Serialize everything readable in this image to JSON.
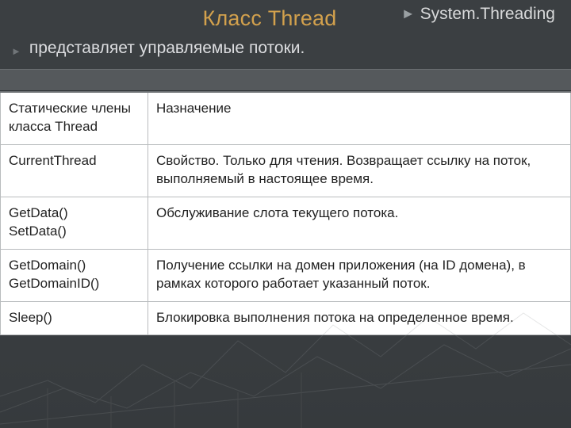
{
  "title": "Класс Thread",
  "namespace": "System.Threading",
  "subtitle": "представляет управляемые потоки.",
  "table": {
    "header": {
      "left": "Статические члены класса Thread",
      "right": "Назначение"
    },
    "rows": [
      {
        "left_lines": [
          "CurrentThread"
        ],
        "right": "Свойство. Только для чтения. Возвращает ссылку на поток, выполняемый в настоящее время."
      },
      {
        "left_lines": [
          "GetData()",
          "SetData()"
        ],
        "right": "Обслуживание слота текущего потока."
      },
      {
        "left_lines": [
          "GetDomain()",
          "GetDomainID()"
        ],
        "right": "Получение ссылки на домен приложения (на ID домена), в рамках которого работает указанный поток."
      },
      {
        "left_lines": [
          "Sleep()"
        ],
        "right": "Блокировка выполнения потока на определенное время."
      }
    ]
  }
}
